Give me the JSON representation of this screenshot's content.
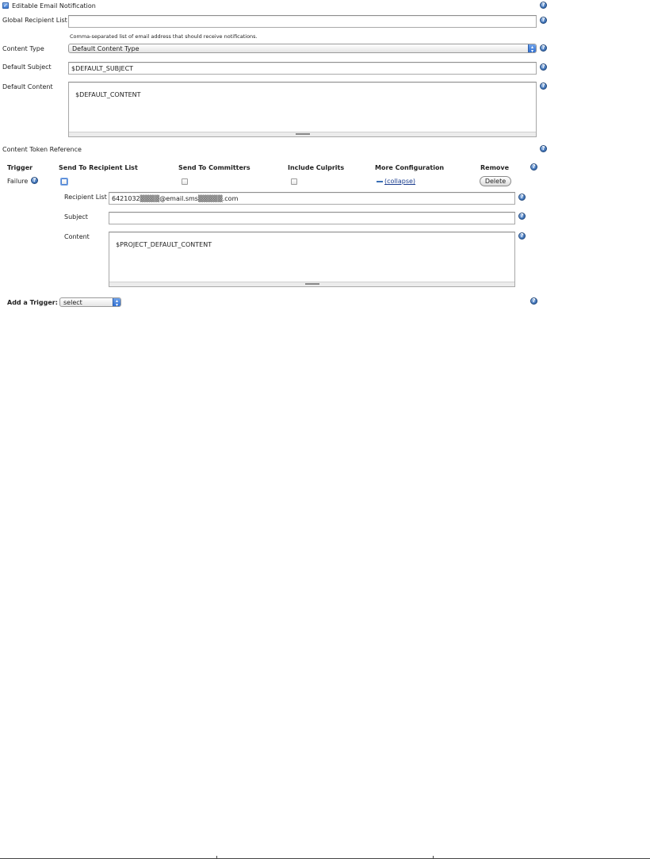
{
  "editable": {
    "checkbox_label": "Editable Email Notification",
    "checked": true
  },
  "global_recipient": {
    "label": "Global Recipient List",
    "value": "",
    "hint": "Comma-separated list of email address that should receive notifications."
  },
  "content_type": {
    "label": "Content Type",
    "selected": "Default Content Type"
  },
  "default_subject": {
    "label": "Default Subject",
    "value": "$DEFAULT_SUBJECT"
  },
  "default_content": {
    "label": "Default Content",
    "value": "$DEFAULT_CONTENT"
  },
  "token_reference": {
    "label": "Content Token Reference"
  },
  "triggers_table": {
    "headers": {
      "trigger": "Trigger",
      "send_to_recipient": "Send To Recipient List",
      "send_to_committers": "Send To Committers",
      "include_culprits": "Include Culprits",
      "more_config": "More Configuration",
      "remove": "Remove"
    },
    "row": {
      "trigger_name": "Failure",
      "send_to_recipient": false,
      "send_to_committers": false,
      "include_culprits": false,
      "collapse_link": "(collapse)",
      "delete_label": "Delete"
    },
    "expanded": {
      "recipient_list_label": "Recipient List",
      "recipient_list_value": "6421032▒▒▒▒@email.sms▒▒▒▒▒.com",
      "subject_label": "Subject",
      "subject_value": "",
      "content_label": "Content",
      "content_value": "$PROJECT_DEFAULT_CONTENT"
    }
  },
  "add_trigger": {
    "label": "Add a Trigger:",
    "selected": "select"
  },
  "icons": {
    "help": "help-icon",
    "check": "checkmark-icon",
    "select_arrow": "select-arrows-icon",
    "collapse": "collapse-minus-icon"
  },
  "colors": {
    "help_icon": "#3a6fb5",
    "link": "#1a3d8f",
    "checkbox_checked": "#3a77cf"
  }
}
